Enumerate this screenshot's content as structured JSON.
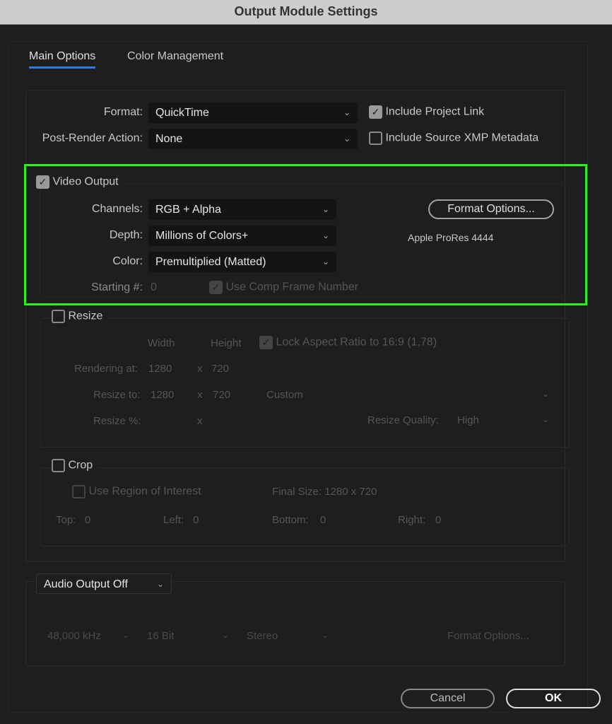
{
  "window": {
    "title": "Output Module Settings"
  },
  "tabs": [
    {
      "label": "Main Options",
      "active": true
    },
    {
      "label": "Color Management",
      "active": false
    }
  ],
  "main": {
    "format": {
      "label": "Format:",
      "value": "QuickTime"
    },
    "post_render": {
      "label": "Post-Render Action:",
      "value": "None"
    },
    "include_project_link": {
      "label": "Include Project Link",
      "checked": true
    },
    "include_xmp": {
      "label": "Include Source XMP Metadata",
      "checked": false
    }
  },
  "video": {
    "label": "Video Output",
    "checked": true,
    "channels": {
      "label": "Channels:",
      "value": "RGB + Alpha"
    },
    "depth": {
      "label": "Depth:",
      "value": "Millions of Colors+"
    },
    "color": {
      "label": "Color:",
      "value": "Premultiplied (Matted)"
    },
    "starting": {
      "label": "Starting #:",
      "value": "0"
    },
    "use_comp_frame": {
      "label": "Use Comp Frame Number",
      "checked": true
    },
    "format_options": "Format Options...",
    "codec": "Apple ProRes 4444"
  },
  "resize": {
    "label": "Resize",
    "checked": false,
    "width_hdr": "Width",
    "height_hdr": "Height",
    "lock": {
      "label": "Lock Aspect Ratio to 16:9 (1,78)",
      "checked": true
    },
    "rendering_at": {
      "label": "Rendering at:",
      "w": "1280",
      "x": "x",
      "h": "720"
    },
    "resize_to": {
      "label": "Resize to:",
      "w": "1280",
      "x": "x",
      "h": "720",
      "preset": "Custom"
    },
    "resize_pct": {
      "label": "Resize %:",
      "x": "x"
    },
    "quality": {
      "label": "Resize Quality:",
      "value": "High"
    }
  },
  "crop": {
    "label": "Crop",
    "checked": false,
    "roi": {
      "label": "Use Region of Interest",
      "checked": false
    },
    "final_size": "Final Size: 1280 x 720",
    "top": {
      "label": "Top:",
      "value": "0"
    },
    "left": {
      "label": "Left:",
      "value": "0"
    },
    "bottom": {
      "label": "Bottom:",
      "value": "0"
    },
    "right": {
      "label": "Right:",
      "value": "0"
    }
  },
  "audio": {
    "mode": "Audio Output Off",
    "rate": "48,000 kHz",
    "bits": "16 Bit",
    "channels": "Stereo",
    "format_options": "Format Options..."
  },
  "footer": {
    "cancel": "Cancel",
    "ok": "OK"
  }
}
